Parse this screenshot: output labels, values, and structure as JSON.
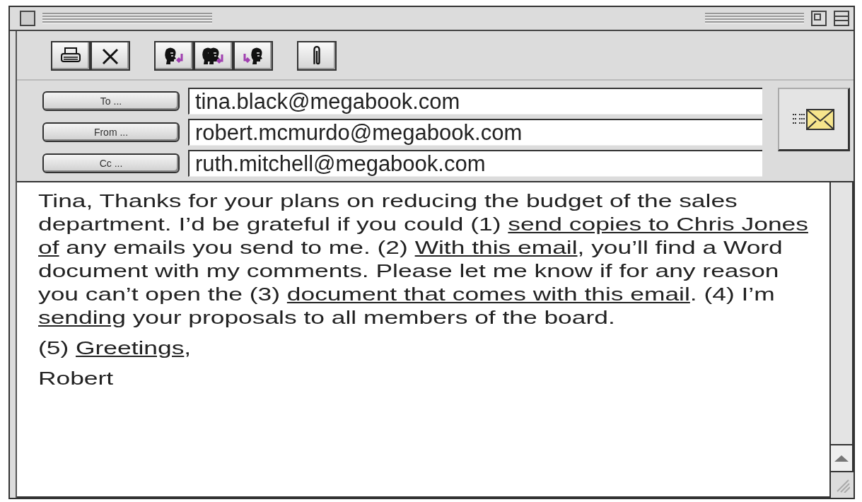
{
  "toolbar": {
    "groups": [
      [
        {
          "kind": "print"
        },
        {
          "kind": "delete"
        }
      ],
      [
        {
          "kind": "reply"
        },
        {
          "kind": "replyall"
        },
        {
          "kind": "forward"
        }
      ],
      [
        {
          "kind": "attach"
        }
      ]
    ]
  },
  "address_fields": [
    {
      "button": "To ...",
      "value": "tina.black@megabook.com"
    },
    {
      "button": "From ...",
      "value": "robert.mcmurdo@megabook.com"
    },
    {
      "button": "Cc ...",
      "value": "ruth.mitchell@megabook.com"
    }
  ],
  "body": [
    [
      {
        "text": "Tina, Thanks for your plans on reducing the budget of the sales department. I’d be grateful if you could (1) ",
        "underlined": false
      },
      {
        "text": "send copies to Chris Jones of",
        "underlined": true
      },
      {
        "text": " any emails you send to me. (2) ",
        "underlined": false
      },
      {
        "text": "With this email",
        "underlined": true
      },
      {
        "text": ", you’ll find a Word document with my comments. Please let me know if for any reason you can’t open the (3) ",
        "underlined": false
      },
      {
        "text": "document that comes with this email",
        "underlined": true
      },
      {
        "text": ". (4) I’m ",
        "underlined": false
      },
      {
        "text": "sending",
        "underlined": true
      },
      {
        "text": " your proposals to all members of the board.",
        "underlined": false
      }
    ],
    [
      {
        "text": "(5) ",
        "underlined": false
      },
      {
        "text": "Greetings",
        "underlined": true
      },
      {
        "text": ",",
        "underlined": false
      }
    ],
    [
      {
        "text": "Robert",
        "underlined": false
      }
    ]
  ]
}
